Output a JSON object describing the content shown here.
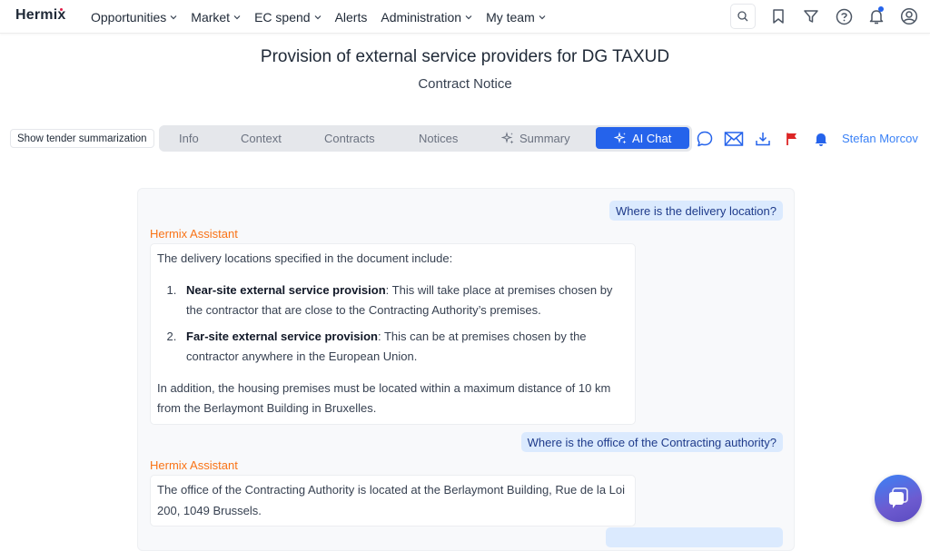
{
  "app": {
    "logo": "Hermix"
  },
  "nav": {
    "items": [
      {
        "label": "Opportunities",
        "dropdown": true
      },
      {
        "label": "Market",
        "dropdown": true
      },
      {
        "label": "EC spend",
        "dropdown": true
      },
      {
        "label": "Alerts",
        "dropdown": false
      },
      {
        "label": "Administration",
        "dropdown": true
      },
      {
        "label": "My team",
        "dropdown": true
      }
    ],
    "icons": [
      "search-icon",
      "bookmark-icon",
      "filter-icon",
      "help-icon",
      "notifications-icon",
      "account-icon"
    ],
    "notification_badge": true
  },
  "page": {
    "title": "Provision of external service providers for DG TAXUD",
    "subtitle": "Contract Notice"
  },
  "toolbar": {
    "summarize_button": "Show tender summarization",
    "tabs": [
      {
        "label": "Info",
        "active": false
      },
      {
        "label": "Context",
        "active": false
      },
      {
        "label": "Contracts",
        "active": false
      },
      {
        "label": "Notices",
        "active": false
      },
      {
        "label": "Summary",
        "active": false,
        "icon": "sparkles-icon"
      },
      {
        "label": "AI Chat",
        "active": true,
        "icon": "sparkles-icon"
      }
    ],
    "actions": [
      "comment-icon",
      "email-icon",
      "download-icon",
      "flag-icon",
      "bell-icon"
    ],
    "user_name": "Stefan Morcov"
  },
  "colors": {
    "accent": "#2563eb",
    "assistant_label": "#f97316",
    "user_bubble": "#dbeafe",
    "flag": "#dc2626"
  },
  "chat": {
    "messages": [
      {
        "role": "user",
        "text": "Where is the delivery location?"
      },
      {
        "role": "assistant",
        "sender": "Hermix Assistant",
        "intro": "The delivery locations specified in the document include:",
        "list": [
          {
            "bold": "Near-site external service provision",
            "text": ": This will take place at premises chosen by the contractor that are close to the Contracting Authority’s premises."
          },
          {
            "bold": "Far-site external service provision",
            "text": ": This can be at premises chosen by the contractor anywhere in the European Union."
          }
        ],
        "outro": "In addition, the housing premises must be located within a maximum distance of 10 km from the Berlaymont Building in Bruxelles."
      },
      {
        "role": "user",
        "text": "Where is the office of the Contracting authority?"
      },
      {
        "role": "assistant",
        "sender": "Hermix Assistant",
        "intro": "The office of the Contracting Authority is located at the Berlaymont Building, Rue de la Loi 200, 1049 Brussels."
      }
    ]
  }
}
